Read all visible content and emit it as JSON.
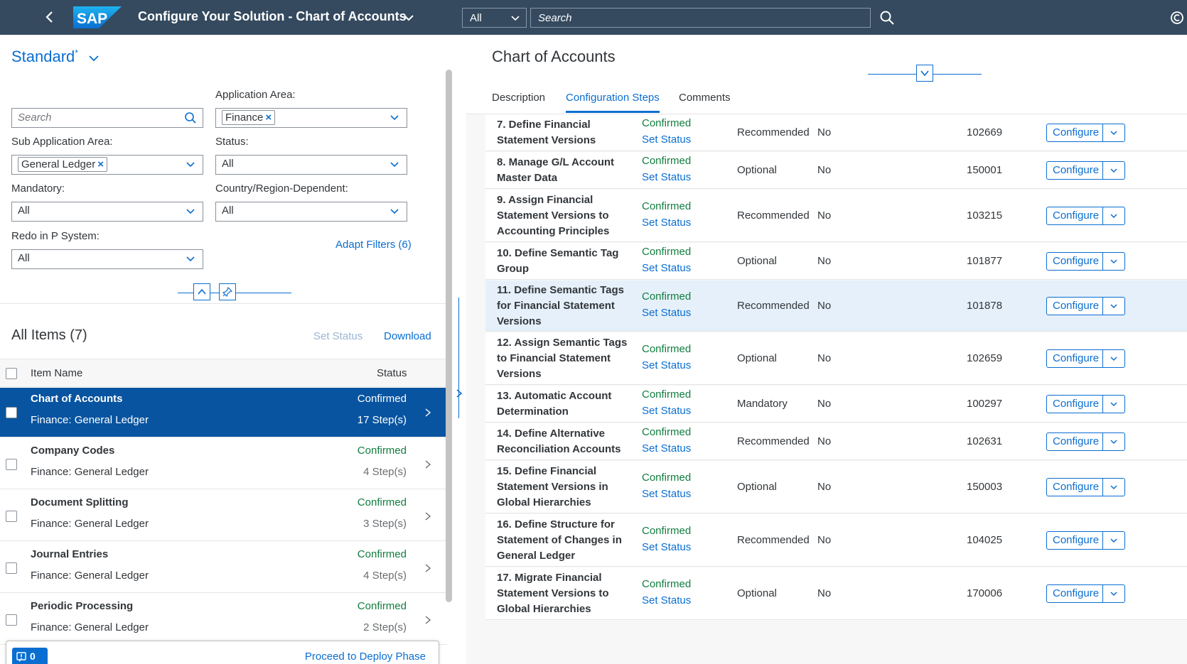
{
  "shell": {
    "title": "Configure Your Solution - Chart of Accounts",
    "logo_text": "SAP",
    "scope": "All",
    "search_placeholder": "Search"
  },
  "filters": {
    "variant": "Standard",
    "variant_modified": "*",
    "search_placeholder": "Search",
    "application_area_label": "Application Area:",
    "application_area_token": "Finance",
    "sub_application_area_label": "Sub Application Area:",
    "sub_application_area_token": "General Ledger",
    "status_label": "Status:",
    "status_value": "All",
    "mandatory_label": "Mandatory:",
    "mandatory_value": "All",
    "country_label": "Country/Region-Dependent:",
    "country_value": "All",
    "redo_label": "Redo in P System:",
    "redo_value": "All",
    "adapt_filters": "Adapt Filters (6)",
    "token_remove": "×"
  },
  "list": {
    "title": "All Items (7)",
    "set_status": "Set Status",
    "download": "Download",
    "col_name": "Item Name",
    "col_status": "Status",
    "items": [
      {
        "name": "Chart of Accounts",
        "sub": "Finance: General Ledger",
        "status": "Confirmed",
        "steps": "17 Step(s)"
      },
      {
        "name": "Company Codes",
        "sub": "Finance: General Ledger",
        "status": "Confirmed",
        "steps": "4 Step(s)"
      },
      {
        "name": "Document Splitting",
        "sub": "Finance: General Ledger",
        "status": "Confirmed",
        "steps": "3 Step(s)"
      },
      {
        "name": "Journal Entries",
        "sub": "Finance: General Ledger",
        "status": "Confirmed",
        "steps": "4 Step(s)"
      },
      {
        "name": "Periodic Processing",
        "sub": "Finance: General Ledger",
        "status": "Confirmed",
        "steps": "2 Step(s)"
      }
    ]
  },
  "footer": {
    "message_count": "0",
    "proceed": "Proceed to Deploy Phase"
  },
  "detail": {
    "title": "Chart of Accounts",
    "tabs": [
      "Description",
      "Configuration Steps",
      "Comments"
    ],
    "configure_label": "Configure",
    "steps": [
      {
        "name": "7. Define Financial Statement Versions",
        "status": "Confirmed",
        "action": "Set Status",
        "type": "Recommended",
        "redo": "No",
        "id": "102669"
      },
      {
        "name": "8. Manage G/L Account Master Data",
        "status": "Confirmed",
        "action": "Set Status",
        "type": "Optional",
        "redo": "No",
        "id": "150001"
      },
      {
        "name": "9. Assign Financial Statement Versions to Accounting Principles",
        "status": "Confirmed",
        "action": "Set Status",
        "type": "Recommended",
        "redo": "No",
        "id": "103215"
      },
      {
        "name": "10. Define Semantic Tag Group",
        "status": "Confirmed",
        "action": "Set Status",
        "type": "Optional",
        "redo": "No",
        "id": "101877"
      },
      {
        "name": "11. Define Semantic Tags for Financial Statement Versions",
        "status": "Confirmed",
        "action": "Set Status",
        "type": "Recommended",
        "redo": "No",
        "id": "101878"
      },
      {
        "name": "12. Assign Semantic Tags to Financial Statement Versions",
        "status": "Confirmed",
        "action": "Set Status",
        "type": "Optional",
        "redo": "No",
        "id": "102659"
      },
      {
        "name": "13. Automatic Account Determination",
        "status": "Confirmed",
        "action": "Set Status",
        "type": "Mandatory",
        "redo": "No",
        "id": "100297"
      },
      {
        "name": "14. Define Alternative Reconciliation Accounts",
        "status": "Confirmed",
        "action": "Set Status",
        "type": "Recommended",
        "redo": "No",
        "id": "102631"
      },
      {
        "name": "15. Define Financial Statement Versions in Global Hierarchies",
        "status": "Confirmed",
        "action": "Set Status",
        "type": "Optional",
        "redo": "No",
        "id": "150003"
      },
      {
        "name": "16. Define Structure for Statement of Changes in General Ledger",
        "status": "Confirmed",
        "action": "Set Status",
        "type": "Recommended",
        "redo": "No",
        "id": "104025"
      },
      {
        "name": "17. Migrate Financial Statement Versions to Global Hierarchies",
        "status": "Confirmed",
        "action": "Set Status",
        "type": "Optional",
        "redo": "No",
        "id": "170006"
      }
    ]
  },
  "colors": {
    "shell": "#354a5f",
    "accent": "#0a6ed1",
    "selected": "#0854a0",
    "positive": "#107e3e"
  }
}
